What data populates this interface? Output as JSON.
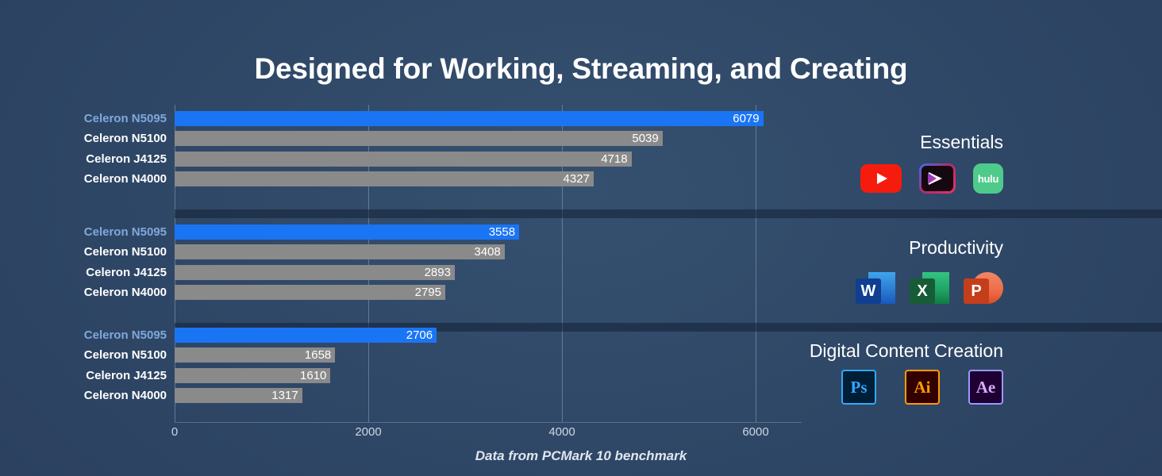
{
  "title": "Designed for Working, Streaming, and Creating",
  "footer": "Data from PCMark 10 benchmark",
  "colors": {
    "background": "#2e4665",
    "bar_highlight": "#1a75f5",
    "bar_default": "#8a8a8a",
    "label_highlight": "#7fa8dd",
    "label_default": "#ffffff"
  },
  "axis": {
    "ticks": [
      "0",
      "2000",
      "4000",
      "6000"
    ],
    "tick_values": [
      0,
      2000,
      4000,
      6000
    ],
    "min": 0,
    "max": 6000
  },
  "categories": [
    {
      "name": "Essentials",
      "icons": [
        {
          "name": "youtube-icon",
          "label": ""
        },
        {
          "name": "prime-video-icon",
          "label": ""
        },
        {
          "name": "hulu-icon",
          "label": "hulu"
        }
      ]
    },
    {
      "name": "Productivity",
      "icons": [
        {
          "name": "microsoft-word-icon",
          "label": "W"
        },
        {
          "name": "microsoft-excel-icon",
          "label": "X"
        },
        {
          "name": "microsoft-powerpoint-icon",
          "label": "P"
        }
      ]
    },
    {
      "name": "Digital Content Creation",
      "icons": [
        {
          "name": "adobe-photoshop-icon",
          "label": "Ps"
        },
        {
          "name": "adobe-illustrator-icon",
          "label": "Ai"
        },
        {
          "name": "adobe-after-effects-icon",
          "label": "Ae"
        }
      ]
    }
  ],
  "chart_data": {
    "type": "bar",
    "orientation": "horizontal",
    "title": "Designed for Working, Streaming, and Creating",
    "subtitle": "Data from PCMark 10 benchmark",
    "xlabel": "",
    "ylabel": "",
    "xlim": [
      0,
      6000
    ],
    "grid": true,
    "legend": "none",
    "categories": [
      "Celeron N5095",
      "Celeron N5100",
      "Celeron J4125",
      "Celeron N4000"
    ],
    "groups": [
      {
        "name": "Essentials",
        "bars": [
          {
            "label": "Celeron N5095",
            "value": 6079,
            "highlight": true
          },
          {
            "label": "Celeron N5100",
            "value": 5039,
            "highlight": false
          },
          {
            "label": "Celeron J4125",
            "value": 4718,
            "highlight": false
          },
          {
            "label": "Celeron N4000",
            "value": 4327,
            "highlight": false
          }
        ]
      },
      {
        "name": "Productivity",
        "bars": [
          {
            "label": "Celeron N5095",
            "value": 3558,
            "highlight": true
          },
          {
            "label": "Celeron N5100",
            "value": 3408,
            "highlight": false
          },
          {
            "label": "Celeron J4125",
            "value": 2893,
            "highlight": false
          },
          {
            "label": "Celeron N4000",
            "value": 2795,
            "highlight": false
          }
        ]
      },
      {
        "name": "Digital Content Creation",
        "bars": [
          {
            "label": "Celeron N5095",
            "value": 2706,
            "highlight": true
          },
          {
            "label": "Celeron N5100",
            "value": 1658,
            "highlight": false
          },
          {
            "label": "Celeron J4125",
            "value": 1610,
            "highlight": false
          },
          {
            "label": "Celeron N4000",
            "value": 1317,
            "highlight": false
          }
        ]
      }
    ]
  }
}
